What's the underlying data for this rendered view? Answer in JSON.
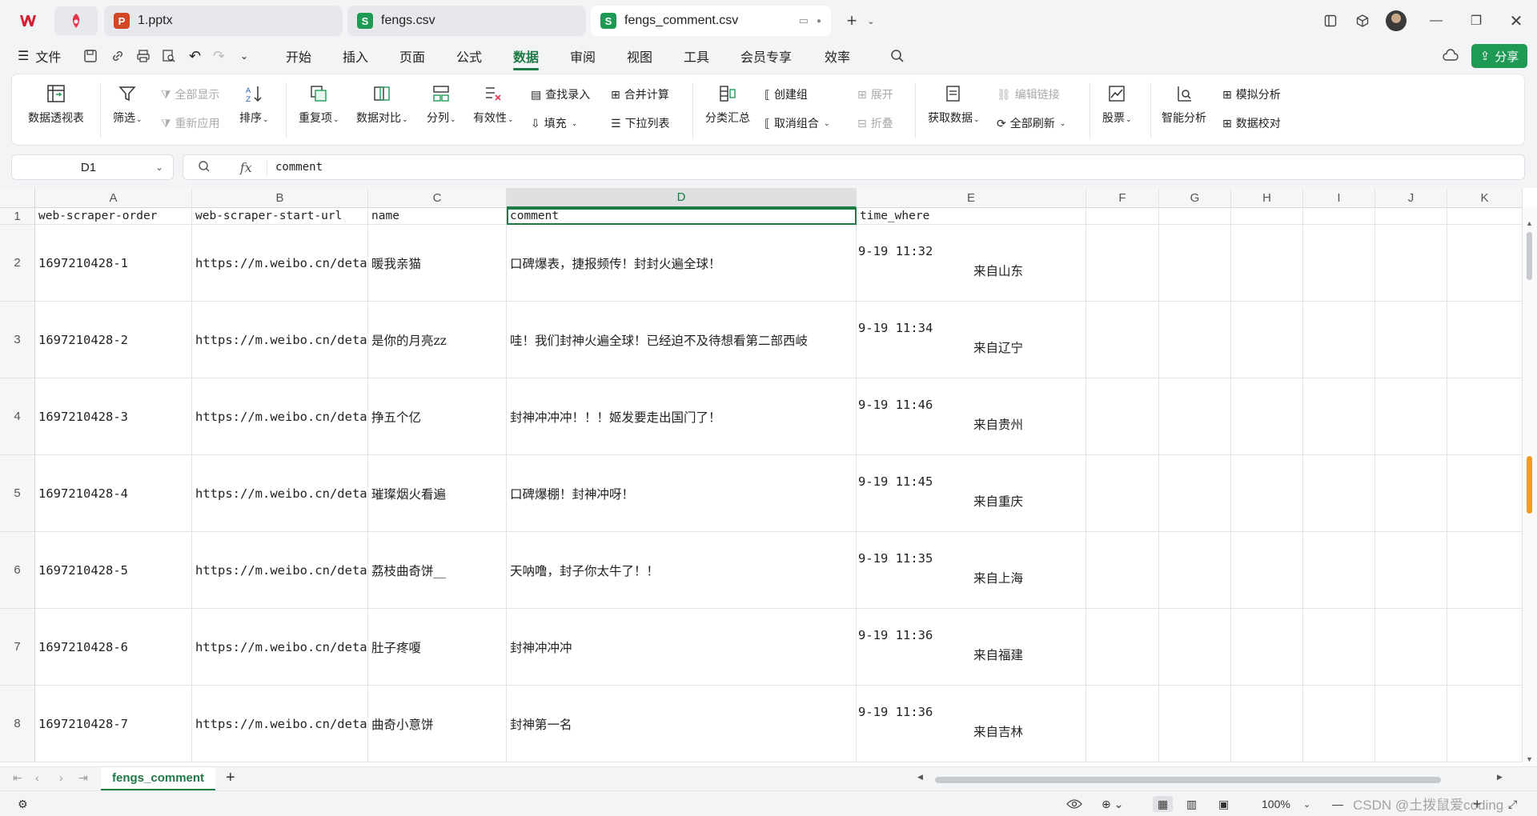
{
  "app": {
    "tabs": [
      {
        "label": "1.pptx",
        "badge": "P",
        "badge_color": "#d24726"
      },
      {
        "label": "fengs.csv",
        "badge": "S",
        "badge_color": "#1e9a55"
      },
      {
        "label": "fengs_comment.csv",
        "badge": "S",
        "badge_color": "#1e9a55"
      }
    ],
    "brand_color": "#d11f2f",
    "accent_color": "#1e7a44"
  },
  "menu": {
    "file": "文件",
    "items": [
      "开始",
      "插入",
      "页面",
      "公式",
      "数据",
      "审阅",
      "视图",
      "工具",
      "会员专享",
      "效率"
    ],
    "active": "数据",
    "share": "分享"
  },
  "ribbon": {
    "pivot": "数据透视表",
    "filter": "筛选",
    "show_all": "全部显示",
    "reapply": "重新应用",
    "sort": "排序",
    "dup": "重复项",
    "compare": "数据对比",
    "split": "分列",
    "validity": "有效性",
    "lookup": "查找录入",
    "fill": "填充",
    "consolidate": "合并计算",
    "dropdown": "下拉列表",
    "subtotal": "分类汇总",
    "group": "创建组",
    "ungroup": "取消组合",
    "expand": "展开",
    "collapse": "折叠",
    "get_data": "获取数据",
    "edit_links": "编辑链接",
    "refresh_all": "全部刷新",
    "stocks": "股票",
    "smart": "智能分析",
    "whatif": "模拟分析",
    "check": "数据校对"
  },
  "formula_bar": {
    "cell_ref": "D1",
    "fx": "fx",
    "value": "comment"
  },
  "columns": [
    "A",
    "B",
    "C",
    "D",
    "E",
    "F",
    "G",
    "H",
    "I",
    "J",
    "K"
  ],
  "selected_column": "D",
  "header_row": {
    "num": "1",
    "cells": [
      "web-scraper-order",
      "web-scraper-start-url",
      "name",
      "comment",
      "time_where"
    ]
  },
  "rows": [
    {
      "num": "2",
      "order": "1697210428-1",
      "url": "https://m.weibo.cn/detai",
      "name": "暖我亲猫",
      "comment": "口碑爆表，捷报频传！封封火遍全球！",
      "time": "9-19 11:32",
      "where": "来自山东"
    },
    {
      "num": "3",
      "order": "1697210428-2",
      "url": "https://m.weibo.cn/detai",
      "name": "是你的月亮zz",
      "comment": "哇！我们封神火遍全球！已经迫不及待想看第二部西岐",
      "time": "9-19 11:34",
      "where": "来自辽宁"
    },
    {
      "num": "4",
      "order": "1697210428-3",
      "url": "https://m.weibo.cn/detai",
      "name": "挣五个亿",
      "comment": "封神冲冲冲！！！姬发要走出国门了！",
      "time": "9-19 11:46",
      "where": "来自贵州"
    },
    {
      "num": "5",
      "order": "1697210428-4",
      "url": "https://m.weibo.cn/detai",
      "name": "璀璨烟火看遍",
      "comment": "口碑爆棚！封神冲呀！",
      "time": "9-19 11:45",
      "where": "来自重庆"
    },
    {
      "num": "6",
      "order": "1697210428-5",
      "url": "https://m.weibo.cn/detai",
      "name": "荔枝曲奇饼__",
      "comment": "天呐噜，封子你太牛了！！",
      "time": "9-19 11:35",
      "where": "来自上海"
    },
    {
      "num": "7",
      "order": "1697210428-6",
      "url": "https://m.weibo.cn/detai",
      "name": "肚子疼嗄",
      "comment": "封神冲冲冲",
      "time": "9-19 11:36",
      "where": "来自福建"
    },
    {
      "num": "8",
      "order": "1697210428-7",
      "url": "https://m.weibo.cn/detai",
      "name": "曲奇小意饼",
      "comment": "封神第一名",
      "time": "9-19 11:36",
      "where": "来自吉林"
    }
  ],
  "sheet": {
    "name": "fengs_comment",
    "add": "+"
  },
  "status": {
    "zoom": "100%"
  },
  "watermark": "CSDN @土拨鼠爱coding"
}
